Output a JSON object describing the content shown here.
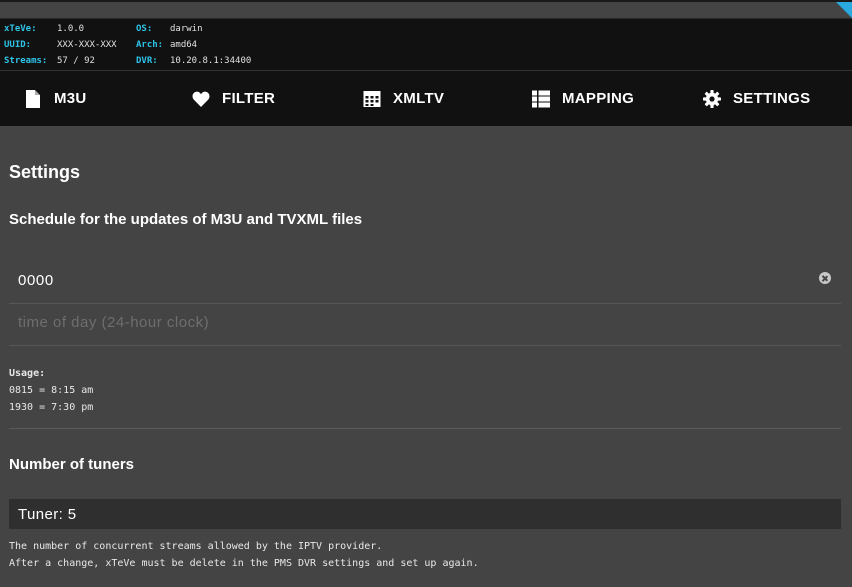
{
  "info": {
    "left": [
      {
        "key": "xTeVe:",
        "value": "1.0.0"
      },
      {
        "key": "UUID:",
        "value": "XXX-XXX-XXX"
      },
      {
        "key": "Streams:",
        "value": "57 / 92"
      }
    ],
    "right": [
      {
        "key": "OS:",
        "value": "darwin"
      },
      {
        "key": "Arch:",
        "value": "amd64"
      },
      {
        "key": "DVR:",
        "value": "10.20.8.1:34400"
      }
    ]
  },
  "nav": [
    {
      "label": "M3U",
      "icon": "file-icon"
    },
    {
      "label": "FILTER",
      "icon": "heart-icon"
    },
    {
      "label": "XMLTV",
      "icon": "calendar-icon"
    },
    {
      "label": "MAPPING",
      "icon": "list-icon"
    },
    {
      "label": "SETTINGS",
      "icon": "gear-icon"
    }
  ],
  "settings": {
    "title": "Settings",
    "schedule_heading": "Schedule for the updates of M3U and TVXML files",
    "schedule_value": "0000",
    "schedule_placeholder": "time of day (24-hour clock)",
    "usage_title": "Usage:",
    "usage_lines": [
      "0815 = 8:15 am",
      "1930 = 7:30 pm"
    ],
    "tuners_heading": "Number of tuners",
    "tuner_value": "Tuner: 5",
    "tuner_desc": [
      "The number of concurrent streams allowed by the IPTV provider.",
      "After a change, xTeVe must be delete in the PMS DVR settings and set up again."
    ]
  },
  "colors": {
    "accent": "#2ec4ea",
    "background": "#444444",
    "header": "#111111"
  }
}
